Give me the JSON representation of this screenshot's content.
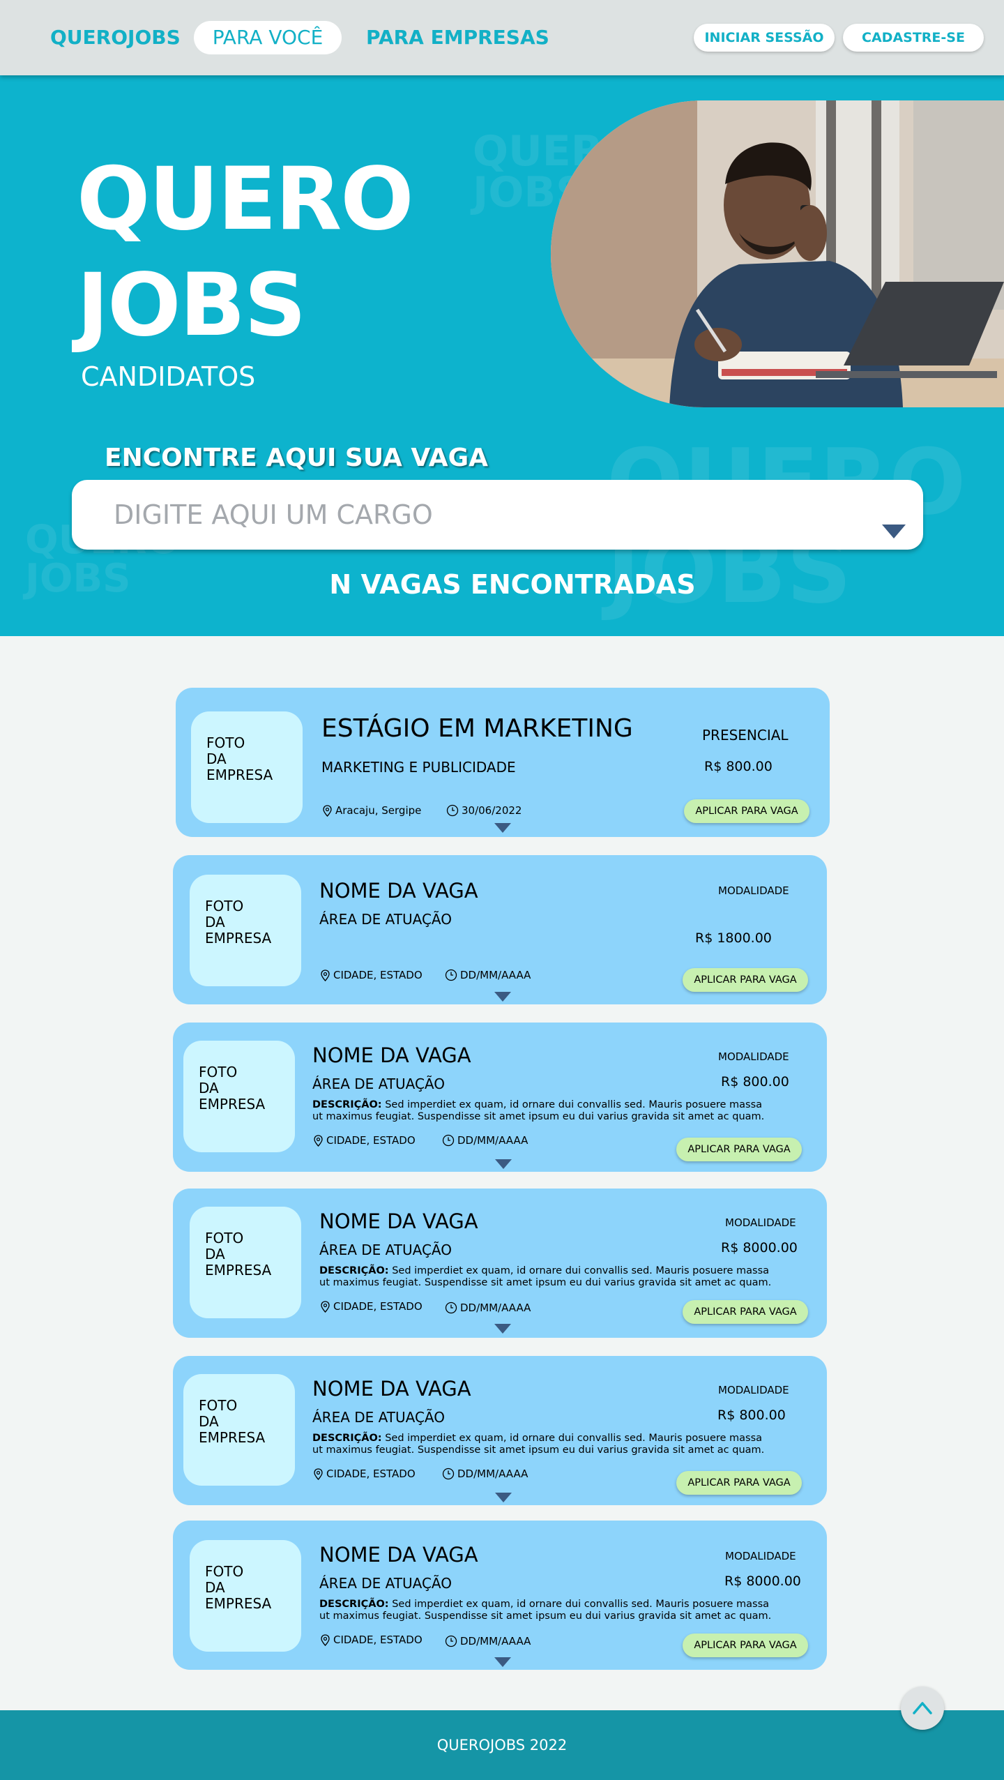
{
  "nav": {
    "brand": "QUEROJOBS",
    "tab_active": "PARA VOCÊ",
    "tab_business": "PARA EMPRESAS",
    "login": "INICIAR SESSÃO",
    "signup": "CADASTRE-SE"
  },
  "hero": {
    "title_line1": "QUERO",
    "title_line2": "JOBS",
    "subtitle": "CANDIDATOS",
    "watermark_line1": "QUERO",
    "watermark_line2": "JOBS",
    "search_label": "ENCONTRE AQUI SUA VAGA",
    "search_placeholder": "DIGITE AQUI UM CARGO",
    "results_count": "N VAGAS ENCONTRADAS"
  },
  "colors": {
    "hero_bg": "#0db3cd",
    "card_bg": "#8dd4fb",
    "logo_bg": "#ccf6ff",
    "apply_bg": "#c7f0b0",
    "footer_bg": "#1595a6",
    "accent_text": "#12b0c6"
  },
  "jobs": [
    {
      "logo_l1": "FOTO",
      "logo_l2": "DA",
      "logo_l3": "EMPRESA",
      "title": "ESTÁGIO EM MARKETING",
      "area": "MARKETING E PUBLICIDADE",
      "mode": "PRESENCIAL",
      "price": "R$ 800.00",
      "desc_label": "",
      "desc": "",
      "location": "Aracaju, Sergipe",
      "date": "30/06/2022",
      "apply": "APLICAR PARA VAGA"
    },
    {
      "logo_l1": "FOTO",
      "logo_l2": "DA",
      "logo_l3": "EMPRESA",
      "title": "NOME DA VAGA",
      "area": "ÁREA DE ATUAÇÃO",
      "mode": "MODALIDADE",
      "price": "R$ 1800.00",
      "desc_label": "",
      "desc": "",
      "location": "CIDADE, ESTADO",
      "date": "DD/MM/AAAA",
      "apply": "APLICAR PARA VAGA"
    },
    {
      "logo_l1": "FOTO",
      "logo_l2": "DA",
      "logo_l3": "EMPRESA",
      "title": "NOME DA VAGA",
      "area": "ÁREA DE ATUAÇÃO",
      "mode": "MODALIDADE",
      "price": "R$ 800.00",
      "desc_label": "DESCRIÇÃO:",
      "desc": "Sed imperdiet ex quam, id ornare dui convallis sed. Mauris posuere massa ut maximus feugiat. Suspendisse sit amet ipsum eu dui varius gravida sit amet ac quam.",
      "location": "CIDADE, ESTADO",
      "date": "DD/MM/AAAA",
      "apply": "APLICAR PARA VAGA"
    },
    {
      "logo_l1": "FOTO",
      "logo_l2": "DA",
      "logo_l3": "EMPRESA",
      "title": "NOME DA VAGA",
      "area": "ÁREA DE ATUAÇÃO",
      "mode": "MODALIDADE",
      "price": "R$ 8000.00",
      "desc_label": "DESCRIÇÃO:",
      "desc": "Sed imperdiet ex quam, id ornare dui convallis sed. Mauris posuere massa ut maximus feugiat. Suspendisse sit amet ipsum eu dui varius gravida sit amet ac quam.",
      "location": "CIDADE, ESTADO",
      "date": "DD/MM/AAAA",
      "apply": "APLICAR PARA VAGA"
    },
    {
      "logo_l1": "FOTO",
      "logo_l2": "DA",
      "logo_l3": "EMPRESA",
      "title": "NOME DA VAGA",
      "area": "ÁREA DE ATUAÇÃO",
      "mode": "MODALIDADE",
      "price": "R$ 800.00",
      "desc_label": "DESCRIÇÃO:",
      "desc": "Sed imperdiet ex quam, id ornare dui convallis sed. Mauris posuere massa ut maximus feugiat. Suspendisse sit amet ipsum eu dui varius gravida sit amet ac quam.",
      "location": "CIDADE, ESTADO",
      "date": "DD/MM/AAAA",
      "apply": "APLICAR PARA VAGA"
    },
    {
      "logo_l1": "FOTO",
      "logo_l2": "DA",
      "logo_l3": "EMPRESA",
      "title": "NOME DA VAGA",
      "area": "ÁREA DE ATUAÇÃO",
      "mode": "MODALIDADE",
      "price": "R$ 8000.00",
      "desc_label": "DESCRIÇÃO:",
      "desc": "Sed imperdiet ex quam, id ornare dui convallis sed. Mauris posuere massa ut maximus feugiat. Suspendisse sit amet ipsum eu dui varius gravida sit amet ac quam.",
      "location": "CIDADE, ESTADO",
      "date": "DD/MM/AAAA",
      "apply": "APLICAR PARA VAGA"
    }
  ],
  "footer": {
    "text": "QUEROJOBS 2022"
  },
  "icons": {
    "location": "location-pin-icon",
    "date": "clock-icon",
    "expand": "chevron-down-icon",
    "back_to_top": "chevron-up-icon"
  }
}
